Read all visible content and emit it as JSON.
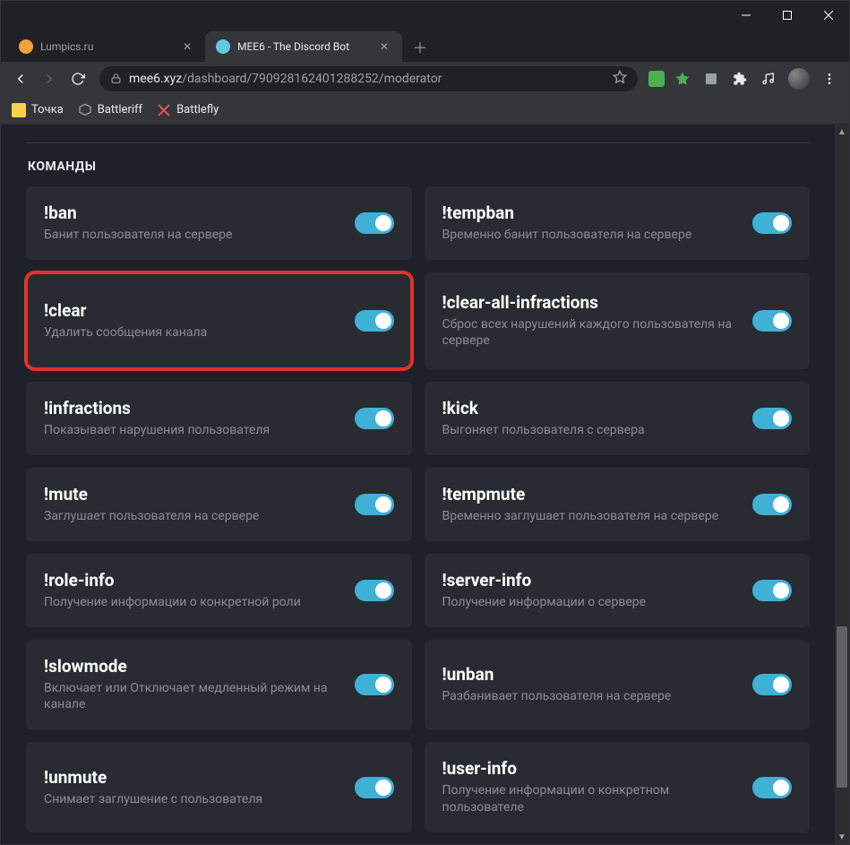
{
  "tabs": [
    {
      "title": "Lumpics.ru",
      "favcolor": "#f2a23a",
      "active": false
    },
    {
      "title": "MEE6 - The Discord Bot",
      "favcolor": "#66c7e0",
      "active": true
    }
  ],
  "url": {
    "secure_host": "mee6.xyz",
    "path": "/dashboard/790928162401288252/moderator"
  },
  "bookmarks": [
    {
      "label": "Точка",
      "iconcolor": "#f8d44c"
    },
    {
      "label": "Battleriff",
      "iconcolor": "#9aa0a6"
    },
    {
      "label": "Battlefly",
      "iconcolor": "#e05555"
    }
  ],
  "section_title": "КОМАНДЫ",
  "commands": [
    {
      "name": "!ban",
      "desc": "Банит пользователя на сервере",
      "on": true,
      "highlight": false
    },
    {
      "name": "!tempban",
      "desc": "Временно банит пользователя на сервере",
      "on": true,
      "highlight": false
    },
    {
      "name": "!clear",
      "desc": "Удалить сообщения канала",
      "on": true,
      "highlight": true
    },
    {
      "name": "!clear-all-infractions",
      "desc": "Сброс всех нарушений каждого пользователя на сервере",
      "on": true,
      "highlight": false
    },
    {
      "name": "!infractions",
      "desc": "Показывает нарушения пользователя",
      "on": true,
      "highlight": false
    },
    {
      "name": "!kick",
      "desc": "Выгоняет пользователя с сервера",
      "on": true,
      "highlight": false
    },
    {
      "name": "!mute",
      "desc": "Заглушает пользователя на сервере",
      "on": true,
      "highlight": false
    },
    {
      "name": "!tempmute",
      "desc": "Временно заглушает пользователя на сервере",
      "on": true,
      "highlight": false
    },
    {
      "name": "!role-info",
      "desc": "Получение информации о конкретной роли",
      "on": true,
      "highlight": false
    },
    {
      "name": "!server-info",
      "desc": "Получение информации о сервере",
      "on": true,
      "highlight": false
    },
    {
      "name": "!slowmode",
      "desc": "Включает или Отключает медленный режим на канале",
      "on": true,
      "highlight": false
    },
    {
      "name": "!unban",
      "desc": "Разбанивает пользователя на сервере",
      "on": true,
      "highlight": false
    },
    {
      "name": "!unmute",
      "desc": "Снимает заглушение с пользователя",
      "on": true,
      "highlight": false
    },
    {
      "name": "!user-info",
      "desc": "Получение информации о конкретном пользователе",
      "on": true,
      "highlight": false
    }
  ]
}
